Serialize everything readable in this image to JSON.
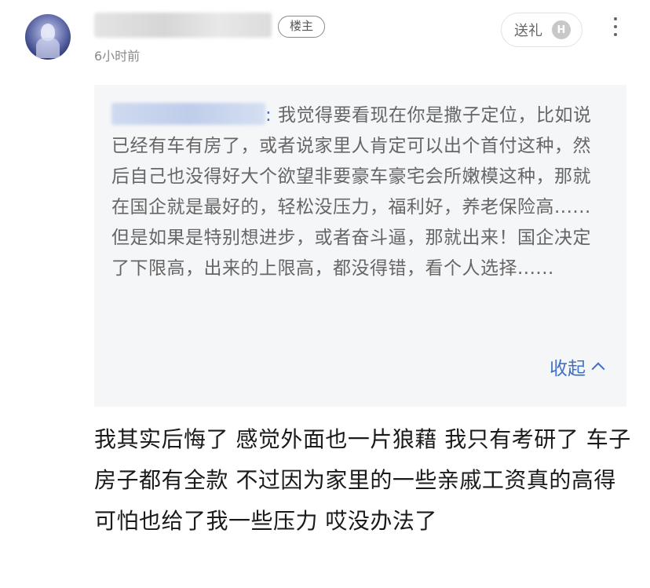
{
  "post": {
    "op_badge": "楼主",
    "time": "6小时前",
    "gift_label": "送礼",
    "gift_icon_letter": "H"
  },
  "quote": {
    "colon": ":",
    "text": " 我觉得要看现在你是撒子定位，比如说已经有车有房了，或者说家里人肯定可以出个首付这种，然后自己也没得好大个欲望非要豪车豪宅会所嫩模这种，那就在国企就是最好的，轻松没压力，福利好，养老保险高......但是如果是特别想进步，或者奋斗逼，那就出来！国企决定了下限高，出来的上限高，都没得错，看个人选择......",
    "collapse_label": "收起"
  },
  "reply": {
    "text": "我其实后悔了 感觉外面也一片狼藉 我只有考研了 车子房子都有全款 不过因为家里的一些亲戚工资真的高得可怕也给了我一些压力 哎没办法了"
  },
  "icons": {
    "avatar": "avatar",
    "more": "more-vertical-icon",
    "collapse": "chevron-up-icon"
  },
  "colors": {
    "link_blue": "#3f6fc7",
    "quote_bg": "#f5f6f8"
  }
}
